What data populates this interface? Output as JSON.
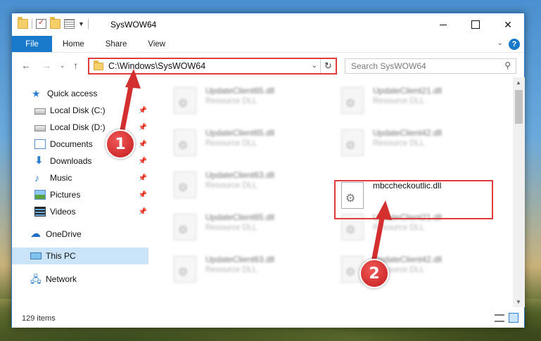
{
  "titlebar": {
    "title": "SysWOW64",
    "quick_access_icons": [
      "folder-icon",
      "properties-icon",
      "new-folder-icon",
      "customize-icon"
    ]
  },
  "ribbon": {
    "tabs": [
      {
        "label": "File"
      },
      {
        "label": "Home"
      },
      {
        "label": "Share"
      },
      {
        "label": "View"
      }
    ],
    "help_label": "?"
  },
  "address_bar": {
    "path": "C:\\Windows\\SysWOW64"
  },
  "search": {
    "placeholder": "Search SysWOW64"
  },
  "nav_pane": {
    "items": [
      {
        "label": "Quick access",
        "icon": "star-icon",
        "pinned": false
      },
      {
        "label": "Local Disk (C:)",
        "icon": "disk-icon",
        "pinned": true
      },
      {
        "label": "Local Disk (D:)",
        "icon": "disk-icon",
        "pinned": true
      },
      {
        "label": "Documents",
        "icon": "documents-icon",
        "pinned": true
      },
      {
        "label": "Downloads",
        "icon": "downloads-icon",
        "pinned": true
      },
      {
        "label": "Music",
        "icon": "music-icon",
        "pinned": true
      },
      {
        "label": "Pictures",
        "icon": "pictures-icon",
        "pinned": true
      },
      {
        "label": "Videos",
        "icon": "videos-icon",
        "pinned": true
      },
      {
        "label": "OneDrive",
        "icon": "onedrive-icon",
        "pinned": false
      },
      {
        "label": "This PC",
        "icon": "this-pc-icon",
        "pinned": false,
        "selected": true
      },
      {
        "label": "Network",
        "icon": "network-icon",
        "pinned": false
      }
    ]
  },
  "files": [
    {
      "name": "UpdateClient65.dll",
      "type": "Resource DLL"
    },
    {
      "name": "UpdateClient21.dll",
      "type": "Resource DLL"
    },
    {
      "name": "UpdateClient65.dll",
      "type": "Resource DLL"
    },
    {
      "name": "UpdateClient42.dll",
      "type": "Resource DLL"
    },
    {
      "name": "UpdateClient63.dll",
      "type": "Resource DLL"
    },
    {
      "name": "mbccheckoutlic.dll",
      "type": "",
      "highlighted": true
    },
    {
      "name": "UpdateClient65.dll",
      "type": "Resource DLL"
    },
    {
      "name": "UpdateClient21.dll",
      "type": "Resource DLL"
    },
    {
      "name": "UpdateClient63.dll",
      "type": "Resource DLL"
    },
    {
      "name": "UpdateClient42.dll",
      "type": "Resource DLL"
    }
  ],
  "status": {
    "item_count": "129 items"
  },
  "annotations": {
    "step1": "1",
    "step2": "2",
    "color": "#e13b3b"
  }
}
